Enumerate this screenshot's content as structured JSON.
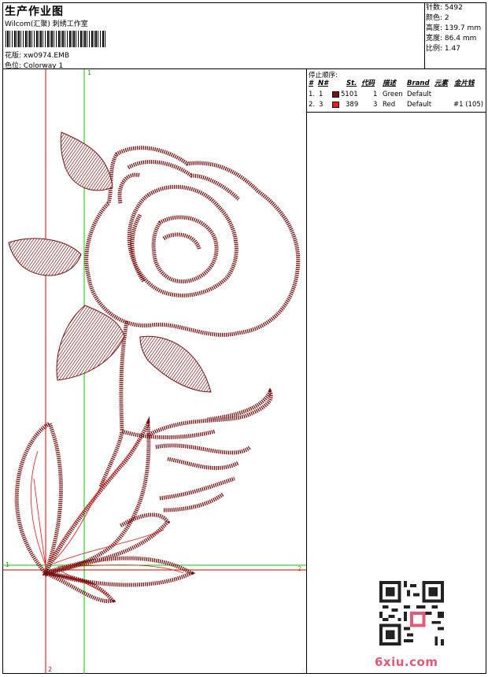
{
  "header": {
    "title": "生产作业图",
    "company": "Wilcom(汇聚) 刺绣工作室",
    "file_label": "花版:",
    "file_name": "xw0974.EMB",
    "colorway_label": "色位:",
    "colorway_name": "Colorway 1"
  },
  "stats": [
    {
      "label": "针数:",
      "value": "5492"
    },
    {
      "label": "颜色:",
      "value": "2"
    },
    {
      "label": "高度:",
      "value": "139.7 mm"
    },
    {
      "label": "宽度:",
      "value": "86.4 mm"
    },
    {
      "label": "比例:",
      "value": "1.47"
    }
  ],
  "legend": {
    "title": "停止顺序:",
    "columns": [
      "#",
      "N#",
      "St.",
      "代码",
      "描述",
      "Brand",
      "元素",
      "金片钱"
    ],
    "rows": [
      {
        "index": "1.",
        "n": "1",
        "color": "#7a1010",
        "stitches": "5101",
        "code": "1",
        "desc": "Green",
        "brand": "Default",
        "element": ""
      },
      {
        "index": "2.",
        "n": "3",
        "color": "#ff1a1a",
        "stitches": "389",
        "code": "3",
        "desc": "Red",
        "brand": "Default",
        "element": "#1 (105)"
      }
    ]
  },
  "design": {
    "axis_labels": {
      "top": "1",
      "left": "1",
      "right": "2",
      "bottom": "2"
    },
    "guide_colors": {
      "green": "#00cc00",
      "red": "#dd0000",
      "stitch": "#7a1010",
      "outline": "#ee1111"
    }
  },
  "watermark": "6xiu.com"
}
